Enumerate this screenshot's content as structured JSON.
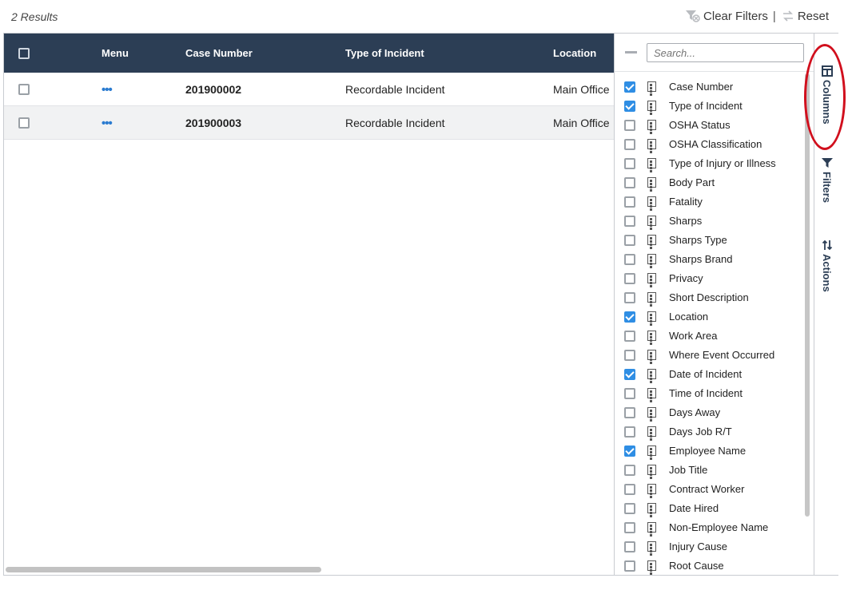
{
  "results_label": "2 Results",
  "toolbar": {
    "clear_filters": "Clear Filters",
    "separator": "|",
    "reset": "Reset"
  },
  "grid": {
    "headers": {
      "menu": "Menu",
      "case_number": "Case Number",
      "type_of_incident": "Type of Incident",
      "location": "Location"
    },
    "rows": [
      {
        "menu": "•••",
        "case_number": "201900002",
        "type_of_incident": "Recordable Incident",
        "location": "Main Office"
      },
      {
        "menu": "•••",
        "case_number": "201900003",
        "type_of_incident": "Recordable Incident",
        "location": "Main Office"
      }
    ]
  },
  "panel": {
    "search_placeholder": "Search...",
    "columns": [
      {
        "label": "Case Number",
        "checked": true
      },
      {
        "label": "Type of Incident",
        "checked": true
      },
      {
        "label": "OSHA Status",
        "checked": false
      },
      {
        "label": "OSHA Classification",
        "checked": false
      },
      {
        "label": "Type of Injury or Illness",
        "checked": false
      },
      {
        "label": "Body Part",
        "checked": false
      },
      {
        "label": "Fatality",
        "checked": false
      },
      {
        "label": "Sharps",
        "checked": false
      },
      {
        "label": "Sharps Type",
        "checked": false
      },
      {
        "label": "Sharps Brand",
        "checked": false
      },
      {
        "label": "Privacy",
        "checked": false
      },
      {
        "label": "Short Description",
        "checked": false
      },
      {
        "label": "Location",
        "checked": true
      },
      {
        "label": "Work Area",
        "checked": false
      },
      {
        "label": "Where Event Occurred",
        "checked": false
      },
      {
        "label": "Date of Incident",
        "checked": true
      },
      {
        "label": "Time of Incident",
        "checked": false
      },
      {
        "label": "Days Away",
        "checked": false
      },
      {
        "label": "Days Job R/T",
        "checked": false
      },
      {
        "label": "Employee Name",
        "checked": true
      },
      {
        "label": "Job Title",
        "checked": false
      },
      {
        "label": "Contract Worker",
        "checked": false
      },
      {
        "label": "Date Hired",
        "checked": false
      },
      {
        "label": "Non-Employee Name",
        "checked": false
      },
      {
        "label": "Injury Cause",
        "checked": false
      },
      {
        "label": "Root Cause",
        "checked": false
      }
    ]
  },
  "side_tabs": {
    "columns": "Columns",
    "filters": "Filters",
    "actions": "Actions"
  },
  "colors": {
    "header_bg": "#2c3e55",
    "checkbox_checked": "#2f8ee4",
    "annotation_oval": "#d10f1d"
  }
}
